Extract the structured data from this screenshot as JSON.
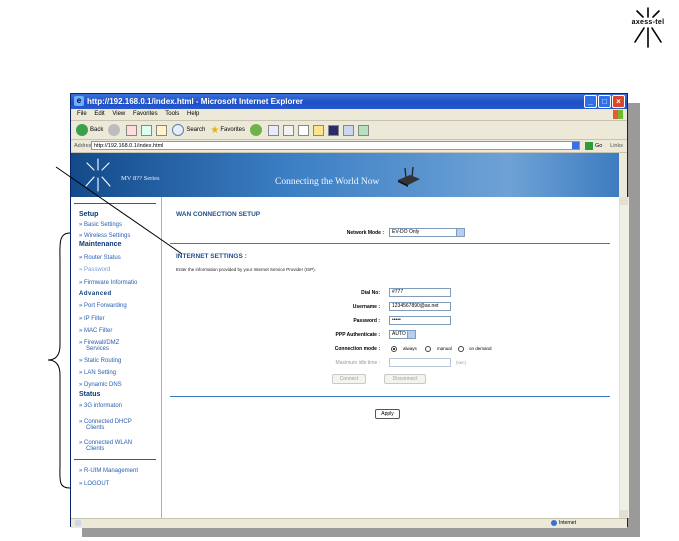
{
  "logo": {
    "brand": "axess-tel"
  },
  "window": {
    "title": "http://192.168.0.1/index.html - Microsoft Internet Explorer",
    "menu": [
      "File",
      "Edit",
      "View",
      "Favorites",
      "Tools",
      "Help"
    ],
    "toolbar": {
      "back": "Back",
      "search": "Search",
      "favorites": "Favorites"
    },
    "address": {
      "label": "Address",
      "value": "http://192.168.0.1/index.html",
      "go": "Go",
      "links": "Links"
    },
    "status": {
      "zone": "Internet"
    }
  },
  "banner": {
    "model": "MV 8?? Series",
    "slogan": "Connecting the World Now"
  },
  "sidebar": {
    "setup": "Setup",
    "basic_settings": "» Basic Settings",
    "wireless_settings": "» Wireless Settings",
    "maintenance": "Maintenance",
    "router_status": "» Router Status",
    "password": "» Password",
    "firmware": "» Firmware Informatio",
    "advanced": "Advanced",
    "port_forwarding": "» Port Forwarding",
    "ip_filter": "» IP Filter",
    "mac_filter": "» MAC Filter",
    "firewall_dmz": "» Firewall/DMZ",
    "firewall_dmz_2": "Services",
    "static_routing": "» Static Routing",
    "lan_setting": "» LAN Setting",
    "dynamic_dns": "» Dynamic DNS",
    "status": "Status",
    "3g_info": "» 3G informaton",
    "dhcp_clients": "» Connected DHCP",
    "dhcp_clients_2": "Clients",
    "wlan_clients": "» Connected WLAN",
    "wlan_clients_2": "Clients",
    "rum": "» R-UIM Management",
    "logout": "» LOGOUT"
  },
  "main": {
    "title": "WAN CONNECTION SETUP",
    "network_mode_label": "Network Mode :",
    "network_mode_value": "EV-DO Only",
    "internet_settings": "INTERNET SETTINGS :",
    "description": "Enter the information provided by your Internet Service Provider (ISP).",
    "dial_label": "Dial No:",
    "dial_value": "#777",
    "username_label": "Username :",
    "username_value": "1234567890@ax.net",
    "password_label": "Password :",
    "password_value": "•••••",
    "ppp_label": "PPP Authenticate :",
    "ppp_value": "AUTO",
    "conn_mode_label": "Connection mode :",
    "conn_always": "always",
    "conn_manual": "manual",
    "conn_demand": "on demand",
    "idle_label": "Maximum idle time :",
    "idle_unit": "(sec)",
    "connect": "Connect",
    "disconnect": "Disconnect",
    "apply": "Apply"
  }
}
